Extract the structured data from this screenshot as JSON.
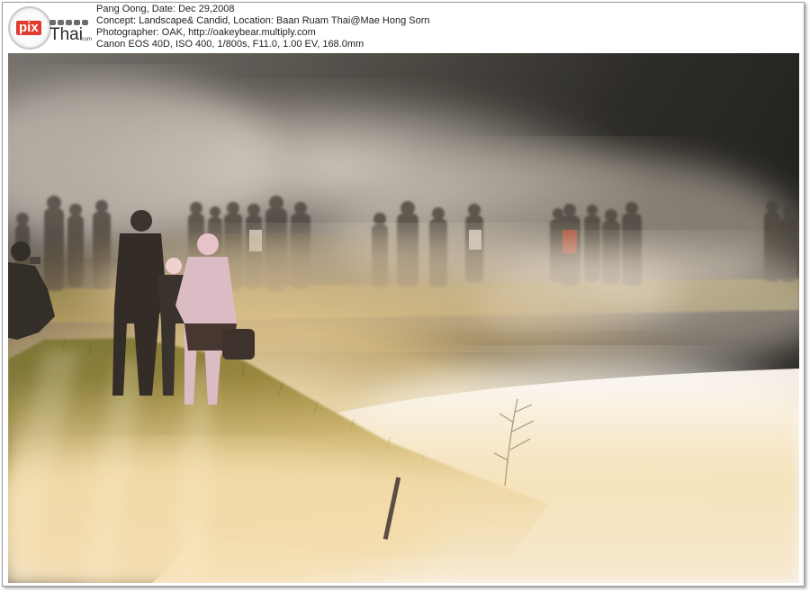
{
  "header": {
    "logo": {
      "brand_main": "pix",
      "brand_secondary": "Thai",
      "brand_suffix": ".com"
    },
    "lines": [
      "Pang Oong, Date: Dec 29,2008",
      "Concept: Landscape& Candid, Location: Baan Ruam Thai@Mae Hong Sorn",
      "Photographer: OAK, http://oakeybear.multiply.com",
      "Canon EOS 40D, ISO 400, 1/800s, F11.0, 1.00 EV, 168.0mm"
    ]
  },
  "photo": {
    "colors": {
      "dark_sky": "#141412",
      "mist": "#e9dcc8",
      "golden_glow": "#f2c86a",
      "grass": "#8a7a2c",
      "water": "#f7f1f4",
      "silhouette": "#2a2420"
    }
  }
}
